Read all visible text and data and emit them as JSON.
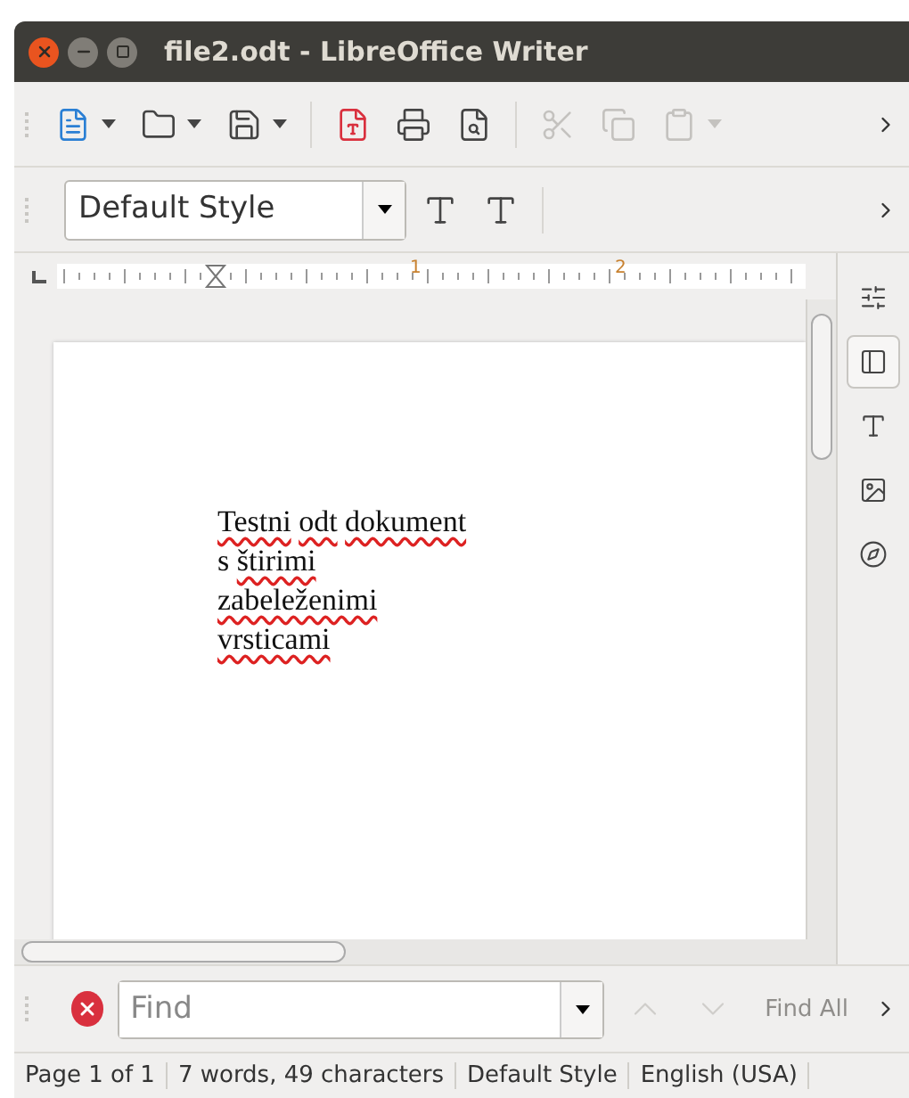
{
  "window": {
    "title": "file2.odt - LibreOffice Writer"
  },
  "standard_toolbar": [
    {
      "kind": "dropdown",
      "disabled": false
    },
    {
      "kind": "dropdown",
      "disabled": false
    },
    {
      "kind": "dropdown",
      "disabled": false
    },
    {
      "kind": "separator"
    },
    {
      "kind": "button",
      "disabled": false
    },
    {
      "kind": "button",
      "disabled": false
    },
    {
      "kind": "button",
      "disabled": false
    },
    {
      "kind": "separator"
    },
    {
      "kind": "button",
      "disabled": true
    },
    {
      "kind": "button",
      "disabled": true
    },
    {
      "kind": "dropdown",
      "disabled": true
    }
  ],
  "formatting_toolbar": {
    "paragraph_style": "Default Style"
  },
  "ruler": {
    "labels": [
      "1",
      "2"
    ]
  },
  "document": {
    "lines": [
      {
        "words": [
          {
            "text": "Testni",
            "misspelled": true
          },
          {
            "text": "odt",
            "misspelled": true
          },
          {
            "text": "dokument",
            "misspelled": true
          }
        ]
      },
      {
        "words": [
          {
            "text": "s",
            "misspelled": false
          },
          {
            "text": "štirimi",
            "misspelled": true
          }
        ]
      },
      {
        "words": [
          {
            "text": "zabeleženimi",
            "misspelled": true
          }
        ]
      },
      {
        "words": [
          {
            "text": "vrsticami",
            "misspelled": true
          }
        ]
      }
    ]
  },
  "sidebar": {
    "tabs": [
      {
        "selected": false
      },
      {
        "selected": true
      },
      {
        "selected": false
      },
      {
        "selected": false
      },
      {
        "selected": false
      }
    ]
  },
  "find_bar": {
    "placeholder": "Find",
    "find_all": "Find All",
    "find_all_disabled": true
  },
  "status_bar": [
    "Page 1 of 1",
    "7 words, 49 characters",
    "Default Style",
    "English (USA)"
  ]
}
